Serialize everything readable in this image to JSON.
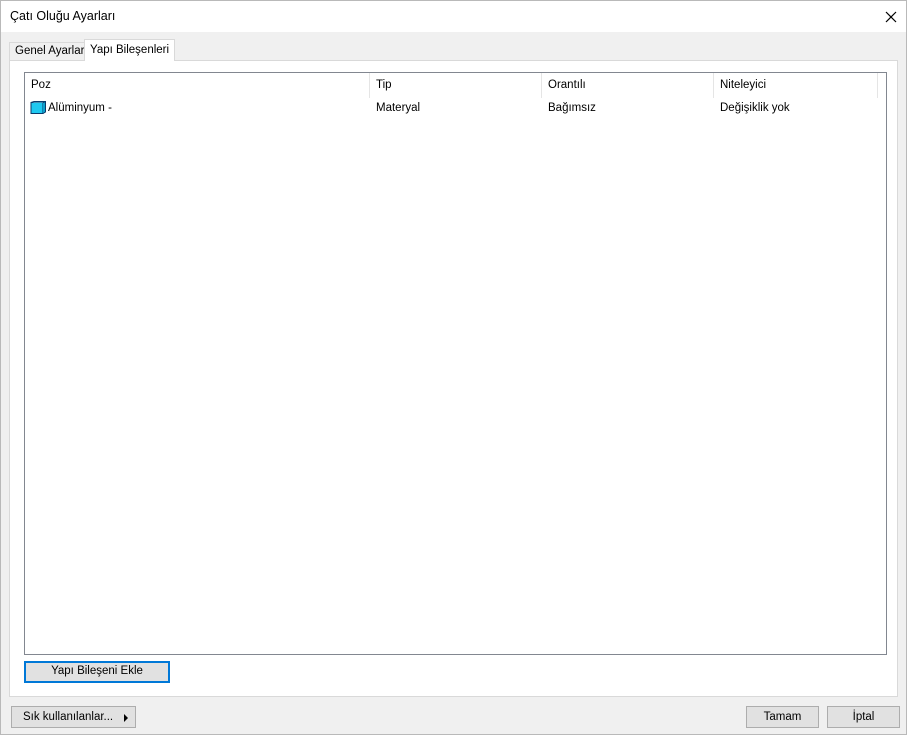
{
  "window": {
    "title": "Çatı Oluğu Ayarları"
  },
  "tabs": [
    {
      "label": "Genel Ayarlar",
      "active": false
    },
    {
      "label": "Yapı Bileşenleri",
      "active": true
    }
  ],
  "list": {
    "columns": [
      "Poz",
      "Tip",
      "Orantılı",
      "Niteleyici"
    ],
    "rows": [
      {
        "icon": "material-icon",
        "poz": "Alüminyum -",
        "tip": "Materyal",
        "orantili": "Bağımsız",
        "niteleyici": "Değişiklik yok"
      }
    ]
  },
  "buttons": {
    "add_component": "Yapı Bileşeni Ekle",
    "favorites": "Sık kullanılanlar...",
    "ok": "Tamam",
    "cancel": "İptal"
  },
  "colors": {
    "focus_border": "#0078d7",
    "icon_fill": "#1ec8f0"
  }
}
